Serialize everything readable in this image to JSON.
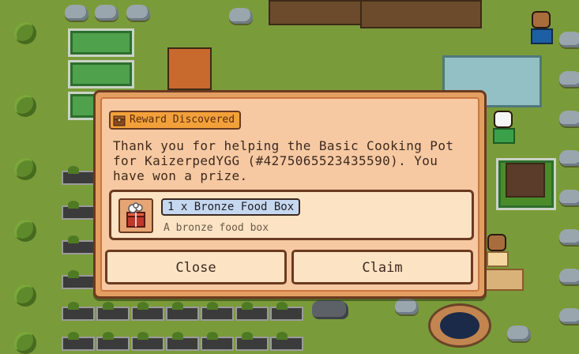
{
  "modal": {
    "tag_label": "Reward Discovered",
    "message": "Thank you for helping the Basic Cooking Pot for KaizerpedYGG (#4275065523435590). You have won a prize.",
    "reward": {
      "name": "1 x Bronze Food Box",
      "description": "A bronze food box",
      "icon": "bronze-food-box-icon"
    },
    "close_label": "Close",
    "claim_label": "Claim"
  },
  "colors": {
    "panel_bg": "#f6c9a2",
    "panel_border": "#6b3a20",
    "tag_bg": "#f2a13a",
    "reward_pill_bg": "#c6d8ef",
    "grass": "#7a9b3a"
  }
}
